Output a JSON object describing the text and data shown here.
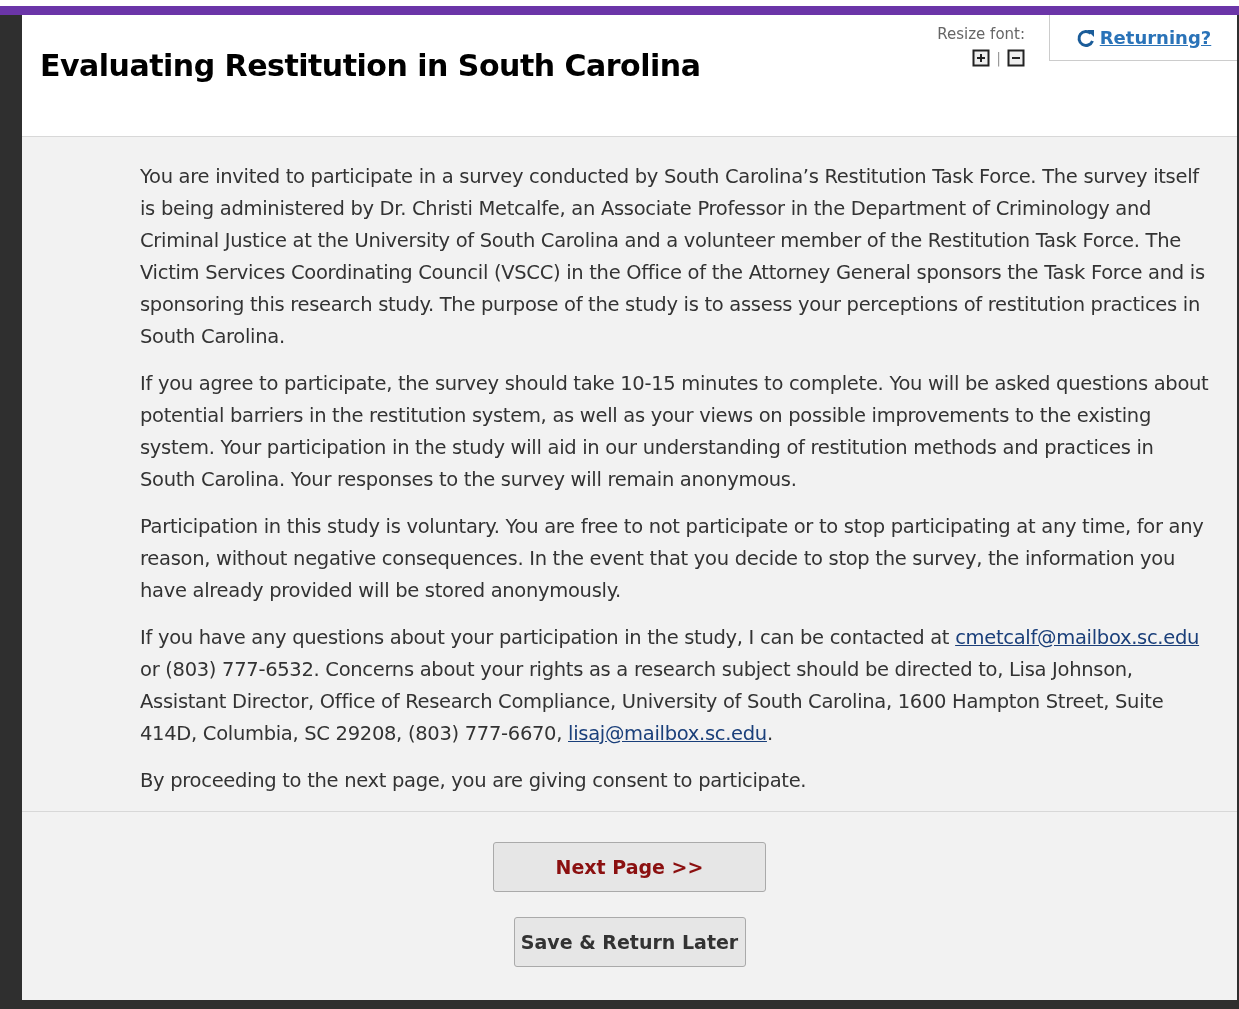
{
  "header": {
    "title": "Evaluating Restitution in South Carolina",
    "resize_font": {
      "label": "Resize font:",
      "separator": "|"
    },
    "returning_link": "Returning?"
  },
  "paragraphs": [
    [
      {
        "kind": "text",
        "text": "You are invited to participate in a survey conducted by South Carolina’s Restitution Task Force. The survey itself is being administered by Dr. Christi Metcalfe, an Associate Professor in the Department of Criminology and Criminal Justice at the University of South Carolina and a volunteer member of the Restitution Task Force. The Victim Services Coordinating Council (VSCC) in the Office of the Attorney General sponsors the Task Force and is sponsoring this research study. The purpose of the study is to assess your perceptions of restitution practices in South Carolina."
      }
    ],
    [
      {
        "kind": "text",
        "text": "If you agree to participate, the survey should take 10-15 minutes to complete. You will be asked questions about potential barriers in the restitution system, as well as your views on possible improvements to the existing system. Your participation in the study will aid in our understanding of restitution methods and practices in South Carolina. Your responses to the survey will remain anonymous."
      }
    ],
    [
      {
        "kind": "text",
        "text": "Participation in this study is voluntary. You are free to not participate or to stop participating at any time, for any reason, without negative consequences. In the event that you decide to stop the survey, the information you have already provided will be stored anonymously."
      }
    ],
    [
      {
        "kind": "text",
        "text": "If you have any questions about your participation in the study, I can be contacted at "
      },
      {
        "kind": "link",
        "text": "cmetcalf@mailbox.sc.edu"
      },
      {
        "kind": "text",
        "text": " or (803) 777-6532. Concerns about your rights as a research subject should be directed to, Lisa Johnson, Assistant Director, Office of Research Compliance, University of South Carolina, 1600 Hampton Street, Suite 414D, Columbia, SC 29208, (803) 777-6670, "
      },
      {
        "kind": "link",
        "text": "lisaj@mailbox.sc.edu"
      },
      {
        "kind": "text",
        "text": "."
      }
    ],
    [
      {
        "kind": "text",
        "text": "By proceeding to the next page, you are giving consent to participate."
      }
    ]
  ],
  "buttons": {
    "next": "Next Page >>",
    "save": "Save & Return Later"
  }
}
